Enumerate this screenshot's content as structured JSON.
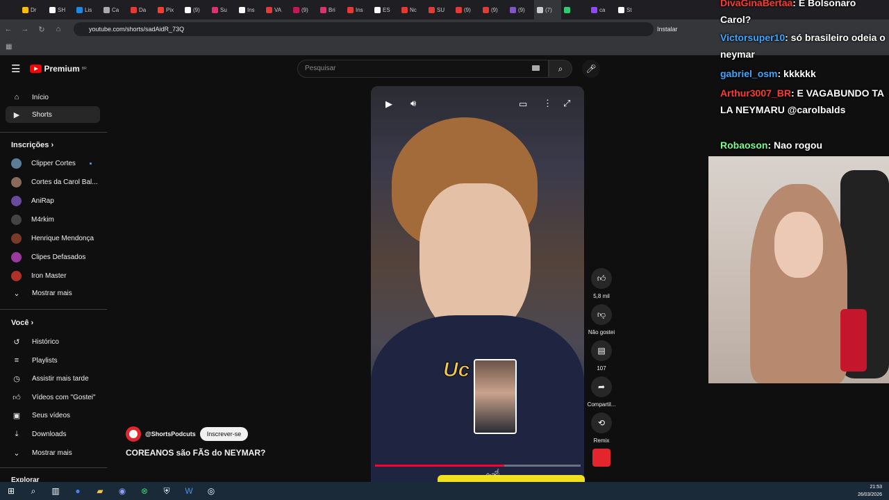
{
  "browser": {
    "tabs": [
      "Dr",
      "SH",
      "Lis",
      "Ca",
      "Da",
      "Pix",
      "(9)",
      "Su",
      "Ins",
      "VA",
      "(9)",
      "Bri",
      "Ins",
      "ES",
      "Nc",
      "SU",
      "(9)",
      "(9)",
      "(9)",
      "(7)",
      "",
      "ca",
      "St"
    ],
    "url": "youtube.com/shorts/sadAidR_73Q",
    "install_label": "Instalar"
  },
  "youtube": {
    "logo_text": "Premium",
    "logo_badge": "BR",
    "search_placeholder": "Pesquisar",
    "sidebar": {
      "items": [
        {
          "label": "Início",
          "icon": "home-icon"
        },
        {
          "label": "Shorts",
          "icon": "shorts-icon"
        }
      ],
      "subs_heading": "Inscrições",
      "subs": [
        "Clipper Cortes",
        "Cortes da Carol Bal...",
        "AniRap",
        "M4rkim",
        "Henrique Mendonça",
        "Clipes Defasados",
        "Iron Master"
      ],
      "show_more": "Mostrar mais",
      "you_heading": "Você",
      "you_items": [
        {
          "label": "Histórico",
          "icon": "history-icon"
        },
        {
          "label": "Playlists",
          "icon": "playlist-icon"
        },
        {
          "label": "Assistir mais tarde",
          "icon": "clock-icon"
        },
        {
          "label": "Vídeos com \"Gostei\"",
          "icon": "thumb-up-icon"
        },
        {
          "label": "Seus vídeos",
          "icon": "video-icon"
        },
        {
          "label": "Downloads",
          "icon": "download-icon"
        }
      ],
      "show_more_2": "Mostrar mais",
      "explore": "Explorar"
    },
    "short": {
      "subtitle_text": "Uc",
      "hover_time": "0:36",
      "progress": 0.63,
      "channel": "@ShortsPodcuts",
      "subscribe_label": "Inscrever-se",
      "title": "COREANOS são FÃS do NEYMAR?",
      "likes": "5,8 mil",
      "dislike_label": "Não gostei",
      "comments": "107",
      "share_label": "Compartil...",
      "remix_label": "Remix"
    }
  },
  "stream_overlay": {
    "chat": [
      {
        "user": "DivaGinaBertaa",
        "text": ": E Bolsonaro Carol?"
      },
      {
        "user": "Victorsuper10",
        "text": ": só brasileiro odeia o neymar"
      },
      {
        "user": "gabriel_osm",
        "text": ": kkkkkk"
      },
      {
        "user": "Arthur3007_BR",
        "text": ": E VAGABUNDO TA LA NEYMARU @carolbalds"
      },
      {
        "user": "Robaoson",
        "text": ": Nao rogou"
      }
    ]
  },
  "taskbar": {
    "time": "21:53",
    "date": "26/03/2026"
  }
}
